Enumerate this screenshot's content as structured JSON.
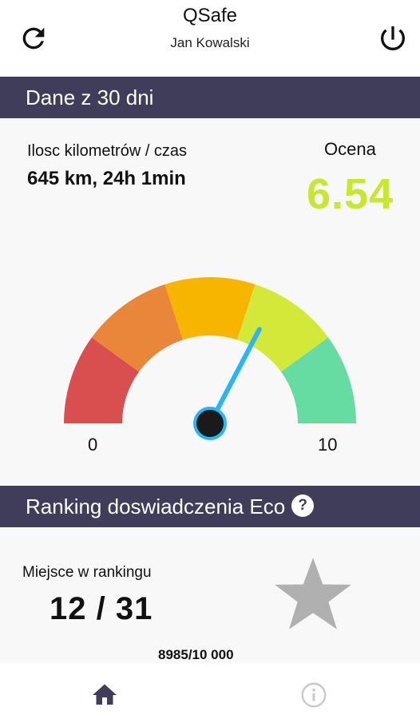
{
  "header": {
    "title": "QSafe",
    "user_name": "Jan Kowalski",
    "left_icon": "refresh-icon",
    "right_icon": "power-icon"
  },
  "period_section": {
    "title": "Dane z 30 dni",
    "distance_time_label": "Ilosc kilometrów / czas",
    "distance_time_value": "645 km, 24h 1min",
    "score_label": "Ocena",
    "score_value": "6.54",
    "score_color": "#c9e632"
  },
  "gauge": {
    "min_label": "0",
    "max_label": "10",
    "min": 0,
    "max": 10,
    "value": 6.54,
    "segment_colors": [
      "#d94f4f",
      "#e9863a",
      "#f7b500",
      "#d4e83a",
      "#66dca3"
    ],
    "needle_color": "#29b6f6"
  },
  "ranking_section": {
    "title": "Ranking doswiadczenia Eco",
    "help_icon": "help-icon",
    "rank_label": "Miejsce w rankingu",
    "rank_value": "12 / 31",
    "points_value": "8985/10 000",
    "star_icon": "star-icon",
    "star_color": "#b0b0b0"
  },
  "bottom_nav": {
    "items": [
      {
        "icon": "home-icon",
        "active": true
      },
      {
        "icon": "info-icon",
        "active": false
      }
    ]
  },
  "colors": {
    "section_bar": "#3f3d59",
    "background": "#f8f8f8"
  }
}
